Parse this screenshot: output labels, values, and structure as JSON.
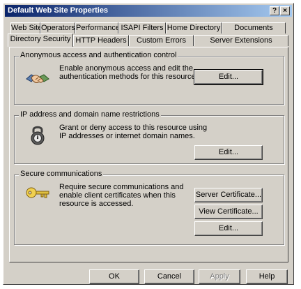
{
  "window": {
    "title": "Default Web Site Properties",
    "help_glyph": "?",
    "close_glyph": "×"
  },
  "tabs_row1": [
    {
      "label": "Web Site"
    },
    {
      "label": "Operators"
    },
    {
      "label": "Performance"
    },
    {
      "label": "ISAPI Filters"
    },
    {
      "label": "Home Directory"
    },
    {
      "label": "Documents"
    }
  ],
  "tabs_row2": [
    {
      "label": "Directory Security",
      "active": true
    },
    {
      "label": "HTTP Headers"
    },
    {
      "label": "Custom Errors"
    },
    {
      "label": "Server Extensions"
    }
  ],
  "anonymous": {
    "label": "Anonymous access and authentication control",
    "description": "Enable anonymous access and edit the\nauthentication methods for this resource.",
    "edit_label": "Edit...",
    "icon": "handshake-icon"
  },
  "ip": {
    "label": "IP address and domain name restrictions",
    "description": "Grant or deny access to this resource using\nIP addresses or internet domain names.",
    "edit_label": "Edit...",
    "icon": "padlock-icon"
  },
  "secure": {
    "label": "Secure communications",
    "description": "Require secure communications and\nenable client certificates when this\nresource is accessed.",
    "server_cert_label": "Server Certificate...",
    "view_cert_label": "View Certificate...",
    "edit_label": "Edit...",
    "icon": "key-icon"
  },
  "footer": {
    "ok_label": "OK",
    "cancel_label": "Cancel",
    "apply_label": "Apply",
    "help_label": "Help"
  },
  "colors": {
    "face": "#d4d0c8",
    "title_start": "#0a246a",
    "title_end": "#a6caf0"
  }
}
